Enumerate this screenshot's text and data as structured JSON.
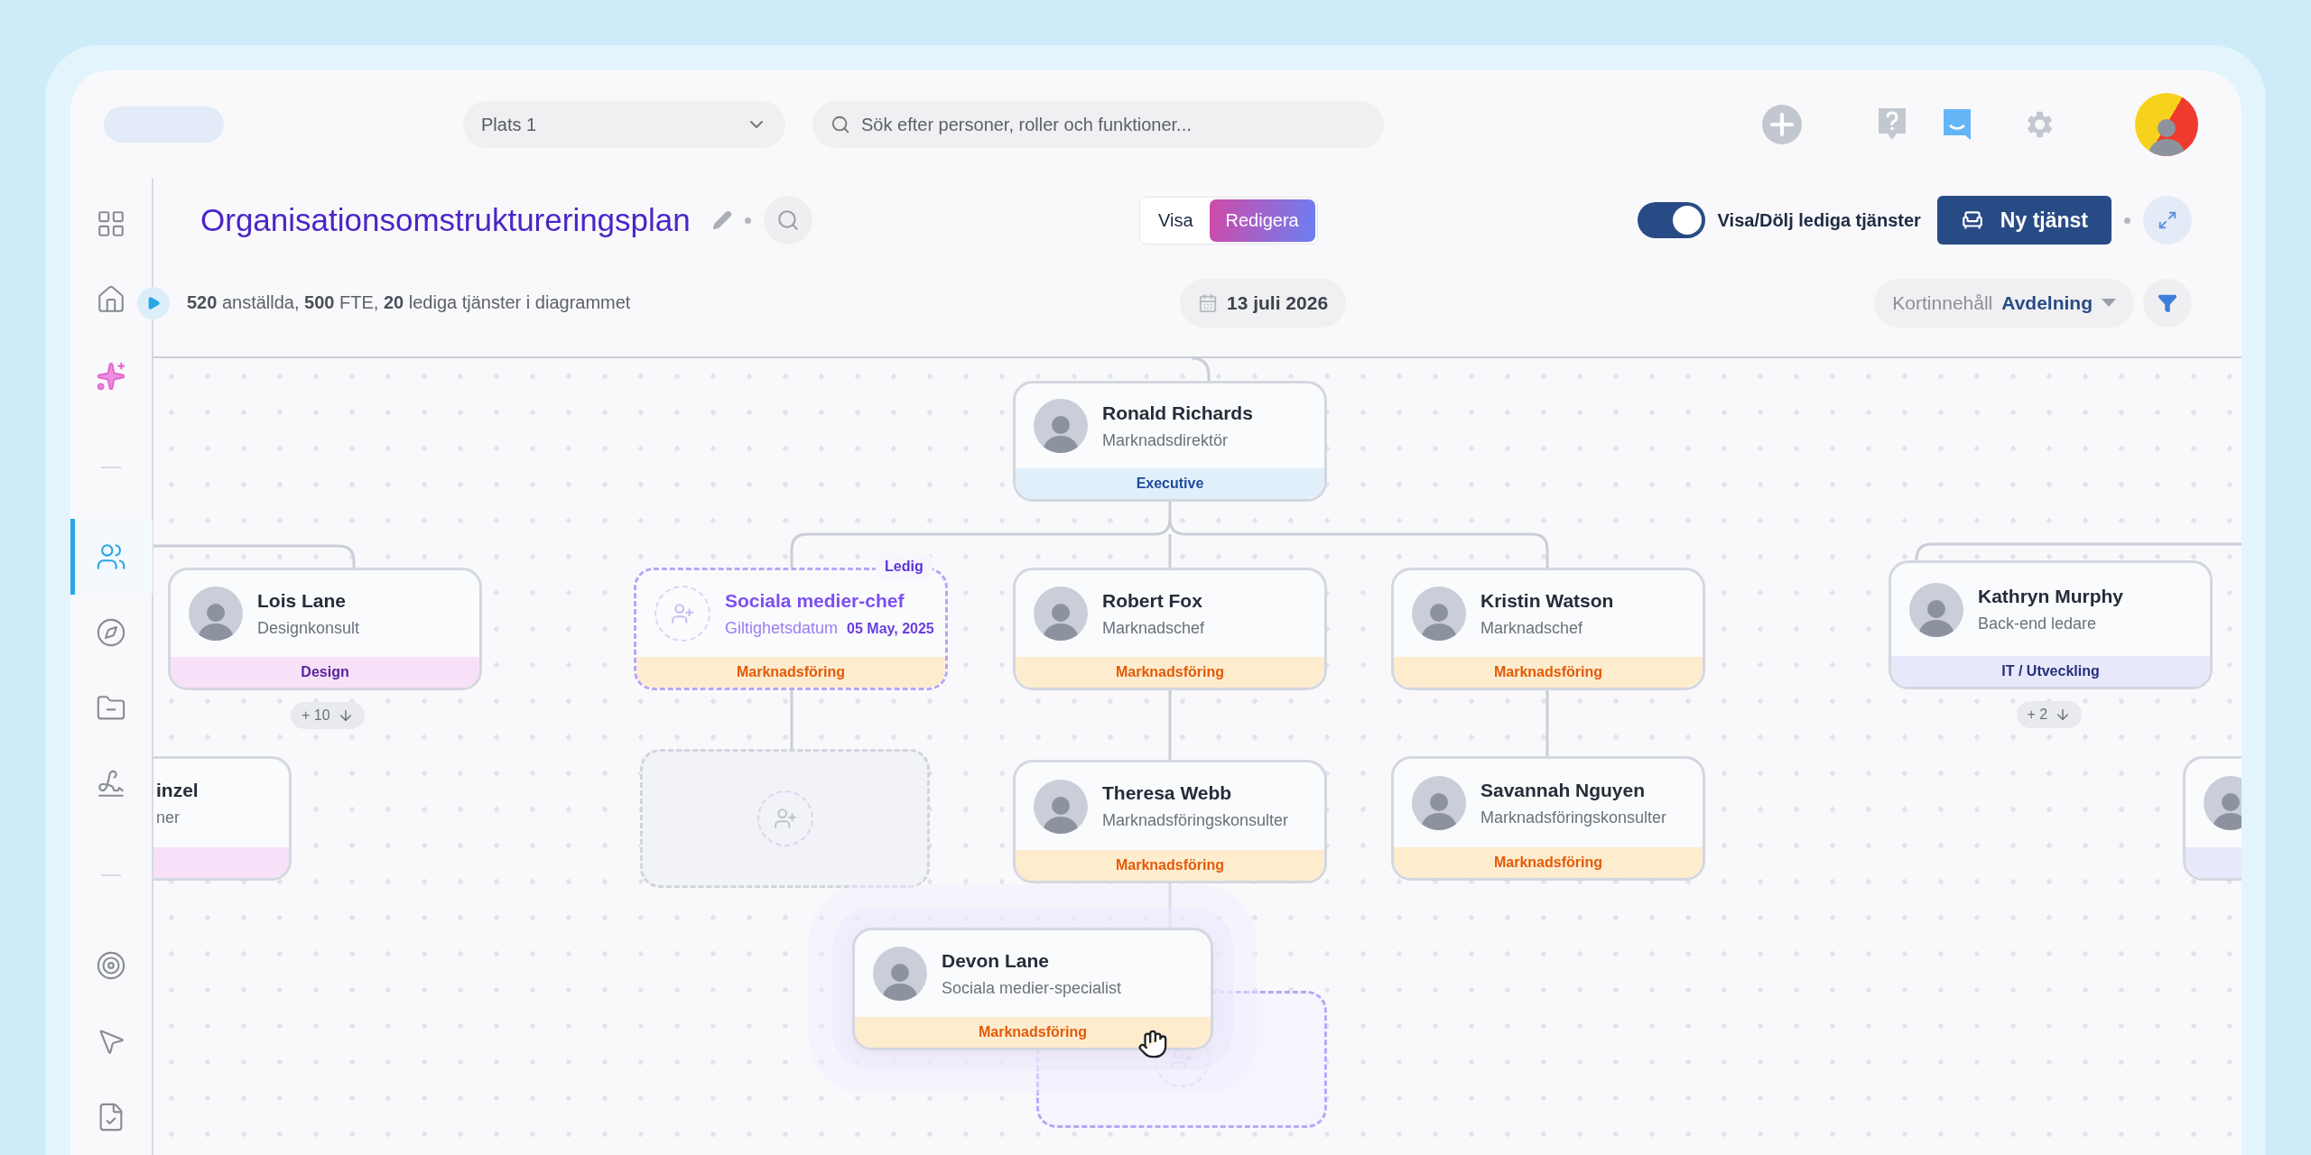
{
  "topbar": {
    "location_select": {
      "value": "Plats 1"
    },
    "search": {
      "placeholder": "Sök efter personer, roller och funktioner..."
    }
  },
  "sidebar": {
    "groups": [
      {
        "items": [
          {
            "kind": "apps",
            "selected": false
          },
          {
            "kind": "home",
            "selected": false
          },
          {
            "kind": "ai",
            "selected": false
          }
        ]
      },
      {
        "items": [
          {
            "kind": "people",
            "selected": true
          },
          {
            "kind": "compass",
            "selected": false
          },
          {
            "kind": "folder",
            "selected": false
          },
          {
            "kind": "signature",
            "selected": false
          }
        ]
      },
      {
        "items": [
          {
            "kind": "target",
            "selected": false
          },
          {
            "kind": "pointer",
            "selected": false
          },
          {
            "kind": "document",
            "selected": false
          }
        ]
      }
    ]
  },
  "chart": {
    "title": "Organisationsomstruktureringsplan",
    "stats": "**520** anställda, **500** FTE, **20** lediga tjänster i diagrammet",
    "mode_tabs": [
      {
        "label": "Visa",
        "selected": false
      },
      {
        "label": "Redigera",
        "selected": true
      }
    ],
    "vacancy_toggle": {
      "label": "Visa/Dölj lediga tjänster",
      "on": true
    },
    "new_position_button": "Ny tjänst",
    "date": "13 juli 2026",
    "card_content": {
      "label": "Kortinnehåll",
      "value": "Avdelning"
    }
  },
  "nodes": [
    {
      "kind": "person",
      "name": "Ronald Richards",
      "role": "Marknadsdirektör",
      "department": "Executive",
      "color": "#e1effb",
      "dragging": false
    },
    {
      "kind": "person",
      "name": "Lois Lane",
      "role": "Designkonsult",
      "department": "Design",
      "color": "#f7e1f8",
      "dragging": false,
      "more": "+ 10"
    },
    {
      "kind": "partial_left",
      "name": "inzel",
      "role": "ner",
      "color": "#f7e1f8"
    },
    {
      "kind": "vacancy",
      "badge": "Ledig",
      "title": "Sociala medier-chef",
      "date_label": "Giltighetsdatum",
      "date": "05 May, 2025",
      "department": "Marknadsföring",
      "color": "#feeccf"
    },
    {
      "kind": "empty_slot"
    },
    {
      "kind": "person",
      "name": "Robert Fox",
      "role": "Marknadschef",
      "department": "Marknadsföring",
      "color": "#feeccf",
      "dragging": false
    },
    {
      "kind": "person",
      "name": "Kristin Watson",
      "role": "Marknadschef",
      "department": "Marknadsföring",
      "color": "#feeccf",
      "dragging": false
    },
    {
      "kind": "person",
      "name": "Theresa Webb",
      "role": "Marknadsföringskonsulter",
      "department": "Marknadsföring",
      "color": "#feeccf",
      "dragging": false
    },
    {
      "kind": "person",
      "name": "Savannah Nguyen",
      "role": "Marknadsföringskonsulter",
      "department": "Marknadsföring",
      "color": "#feeccf",
      "dragging": false
    },
    {
      "kind": "drop_slot"
    },
    {
      "kind": "person",
      "name": "Devon Lane",
      "role": "Sociala medier-specialist",
      "department": "Marknadsföring",
      "color": "#feeccf",
      "dragging": true
    },
    {
      "kind": "person",
      "name": "Kathryn Murphy",
      "role": "Back-end ledare",
      "department": "IT / Utveckling",
      "color": "#e8e8fb",
      "dragging": false,
      "more": "+ 2"
    },
    {
      "kind": "partial_right",
      "color": "#e8e8fb"
    }
  ]
}
